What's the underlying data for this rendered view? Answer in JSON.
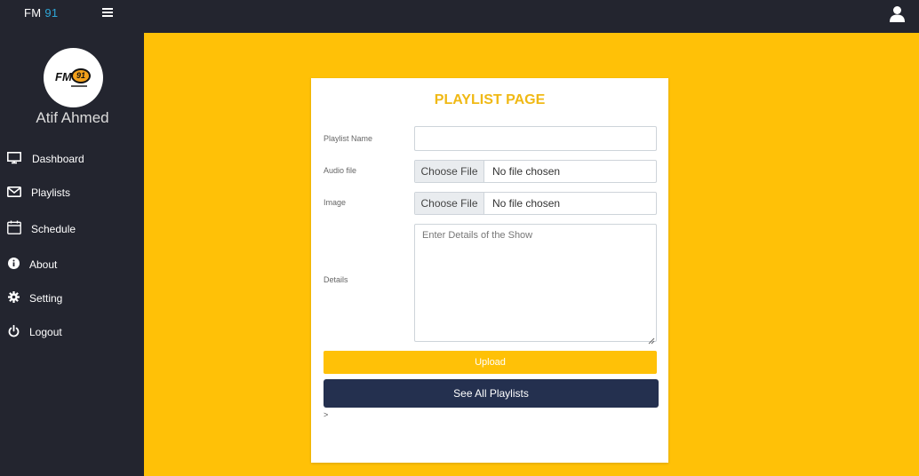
{
  "header": {
    "brand_text": "FM",
    "brand_number": "91",
    "menu_icon": "hamburger-icon",
    "user_icon": "user-icon"
  },
  "sidebar": {
    "logo_text": "FM",
    "logo_badge": "91",
    "username": "Atif Ahmed",
    "items": [
      {
        "label": "Dashboard",
        "icon": "monitor-icon"
      },
      {
        "label": "Playlists",
        "icon": "envelope-icon"
      },
      {
        "label": "Schedule",
        "icon": "calendar-icon"
      },
      {
        "label": "About",
        "icon": "info-icon"
      },
      {
        "label": "Setting",
        "icon": "gear-icon"
      },
      {
        "label": "Logout",
        "icon": "power-icon"
      }
    ]
  },
  "form": {
    "title": "PLAYLIST PAGE",
    "playlist_name_label": "Playlist Name",
    "playlist_name_value": "",
    "audio_label": "Audio file",
    "audio_button": "Choose File",
    "audio_status": "No file chosen",
    "image_label": "Image",
    "image_button": "Choose File",
    "image_status": "No file chosen",
    "details_label": "Details",
    "details_placeholder": "Enter Details of the Show",
    "upload_label": "Upload",
    "see_all_label": "See All Playlists",
    "stray_text": ">"
  },
  "colors": {
    "accent": "#ffc107",
    "sidebar": "#23252f",
    "brand_number": "#2ea7d8",
    "title": "#f0b915",
    "navy_button": "#24304f"
  }
}
